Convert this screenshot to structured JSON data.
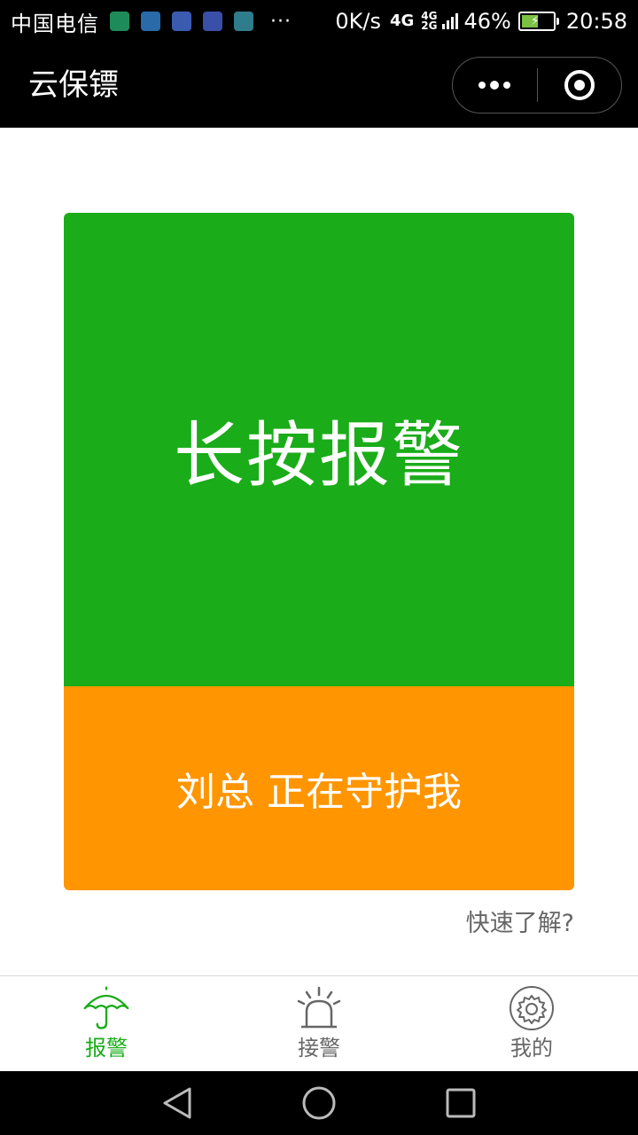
{
  "status_bar": {
    "carrier": "中国电信",
    "more_notifications": "···",
    "net_speed": "0K/s",
    "network_type_primary": "4G",
    "network_type_secondary_top": "4G",
    "network_type_secondary_bottom": "2G",
    "battery_percent": "46%",
    "time": "20:58",
    "notification_icons": [
      {
        "name": "app-icon-1",
        "color": "#1e8c5a"
      },
      {
        "name": "app-icon-2",
        "color": "#2a6aa8"
      },
      {
        "name": "app-icon-3",
        "color": "#3a5bb0"
      },
      {
        "name": "usb-icon",
        "color": "#3a4fa8"
      },
      {
        "name": "image-icon",
        "color": "#2f7d8c"
      }
    ]
  },
  "nav_bar": {
    "title": "云保镖"
  },
  "main": {
    "alarm_button_label": "长按报警",
    "guard_name": "刘总",
    "guard_text": "正在守护我",
    "learn_more_link": "快速了解?"
  },
  "tab_bar": {
    "items": [
      {
        "label": "报警",
        "icon": "umbrella-icon",
        "active": true
      },
      {
        "label": "接警",
        "icon": "siren-icon",
        "active": false
      },
      {
        "label": "我的",
        "icon": "gear-icon",
        "active": false
      }
    ]
  },
  "colors": {
    "alarm_green": "#1aac19",
    "guard_orange": "#ff9500",
    "active_tab": "#1aac19",
    "inactive_tab": "#666666"
  }
}
